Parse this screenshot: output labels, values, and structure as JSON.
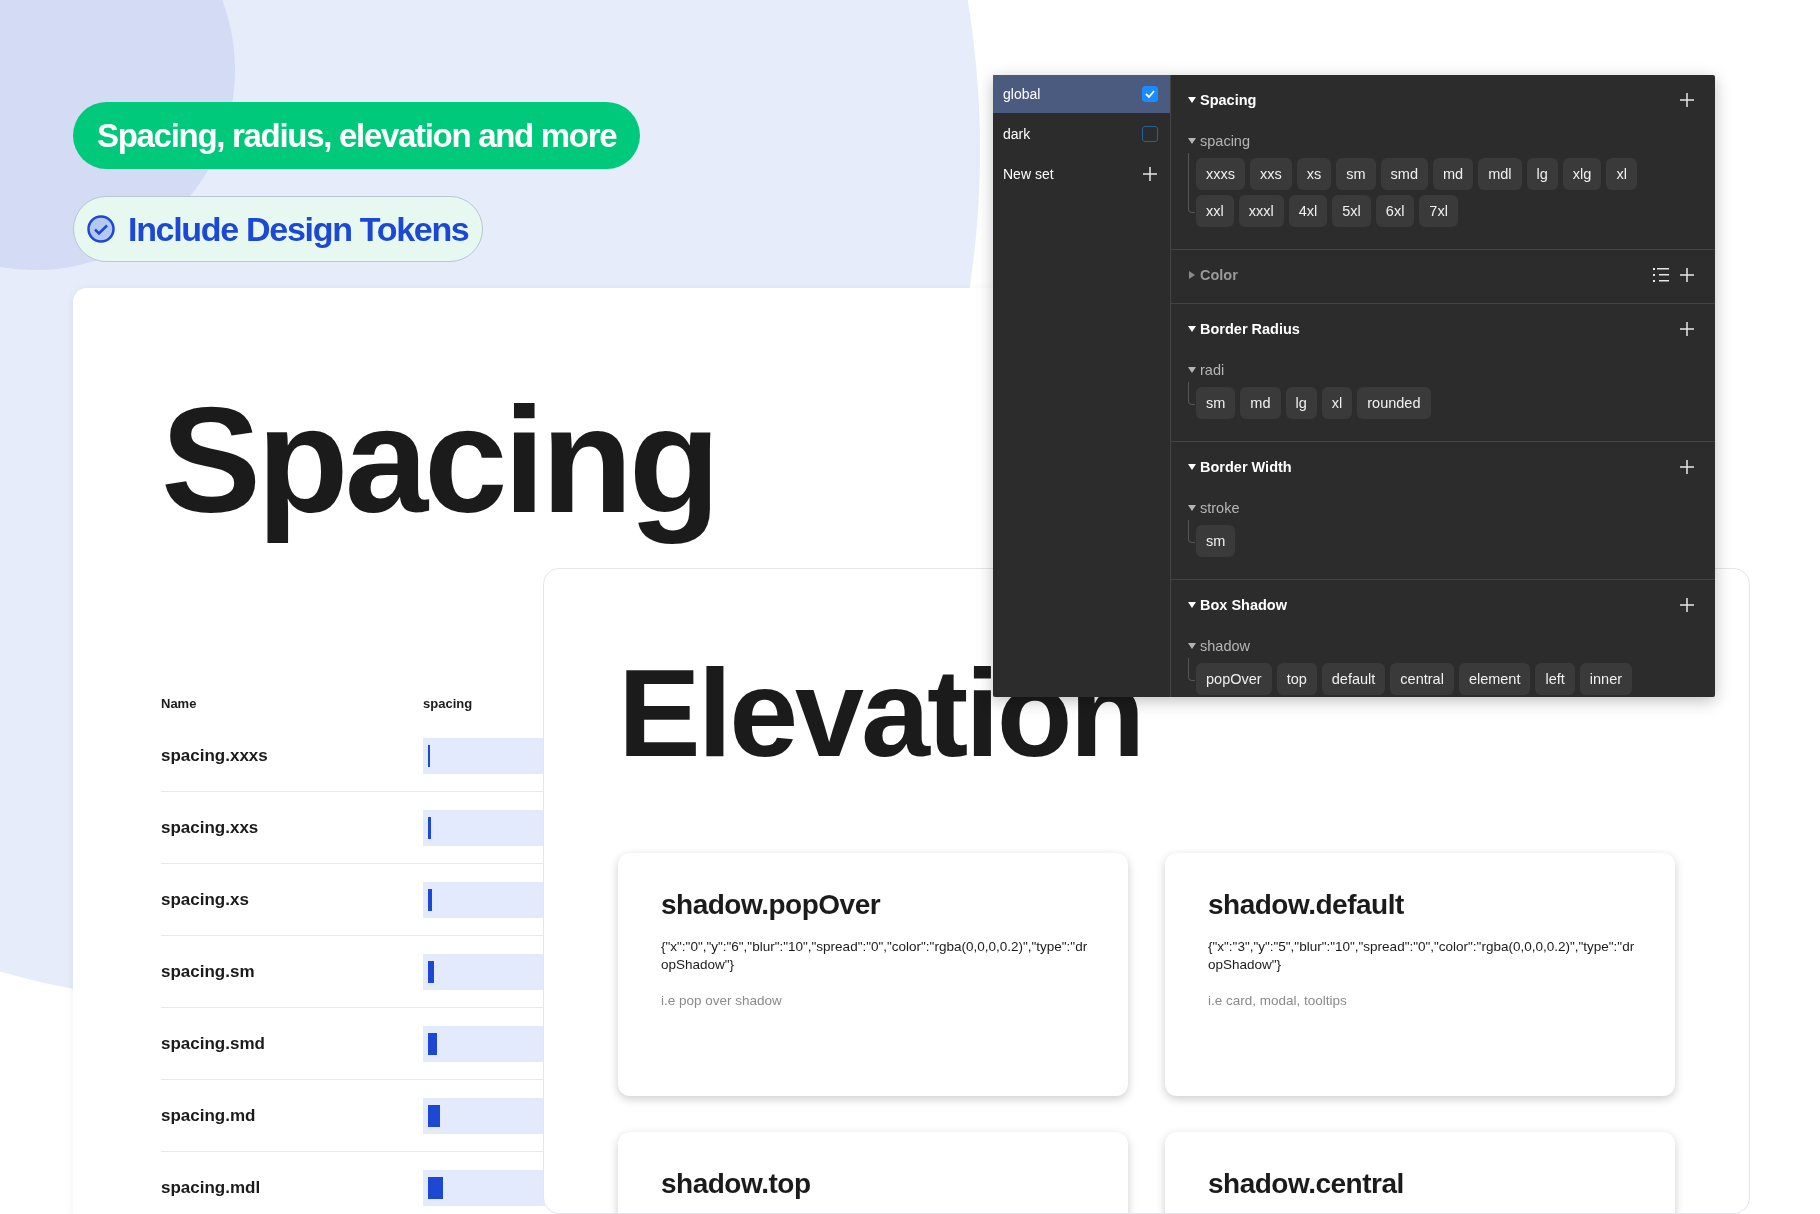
{
  "headline_badge": {
    "text": "Spacing, radius, elevation and more"
  },
  "feature_badge": {
    "text": "Include Design Tokens"
  },
  "spacing_card": {
    "title": "Spacing",
    "columns": [
      "Name",
      "spacing"
    ],
    "rows": [
      {
        "name": "spacing.xxxs",
        "level": 0.01
      },
      {
        "name": "spacing.xxs",
        "level": 0.015
      },
      {
        "name": "spacing.xs",
        "level": 0.02
      },
      {
        "name": "spacing.sm",
        "level": 0.03
      },
      {
        "name": "spacing.smd",
        "level": 0.045
      },
      {
        "name": "spacing.md",
        "level": 0.06
      },
      {
        "name": "spacing.mdl",
        "level": 0.075
      }
    ]
  },
  "elevation_card": {
    "title": "Elevation",
    "cards": [
      {
        "title": "shadow.popOver",
        "value": "{\"x\":\"0\",\"y\":\"6\",\"blur\":\"10\",\"spread\":\"0\",\"color\":\"rgba(0,0,0,0.2)\",\"type\":\"dropShadow\"}",
        "description": "i.e pop over shadow"
      },
      {
        "title": "shadow.default",
        "value": "{\"x\":\"3\",\"y\":\"5\",\"blur\":\"10\",\"spread\":\"0\",\"color\":\"rgba(0,0,0,0.2)\",\"type\":\"dropShadow\"}",
        "description": "i.e card, modal, tooltips"
      },
      {
        "title": "shadow.top"
      },
      {
        "title": "shadow.central"
      }
    ]
  },
  "token_panel": {
    "sets": [
      {
        "label": "global",
        "selected": true,
        "kind": "checkbox",
        "checked": true
      },
      {
        "label": "dark",
        "selected": false,
        "kind": "checkbox",
        "checked": false
      },
      {
        "label": "New set",
        "selected": false,
        "kind": "add"
      }
    ],
    "sections": [
      {
        "title": "Spacing",
        "expanded": true,
        "list_view": false,
        "groups": [
          {
            "name": "spacing",
            "expanded": true,
            "tokens": [
              "xxxs",
              "xxs",
              "xs",
              "sm",
              "smd",
              "md",
              "mdl",
              "lg",
              "xlg",
              "xl",
              "xxl",
              "xxxl",
              "4xl",
              "5xl",
              "6xl",
              "7xl"
            ]
          }
        ]
      },
      {
        "title": "Color",
        "expanded": false,
        "list_view": true
      },
      {
        "title": "Border Radius",
        "expanded": true,
        "list_view": false,
        "groups": [
          {
            "name": "radi",
            "expanded": true,
            "tokens": [
              "sm",
              "md",
              "lg",
              "xl",
              "rounded"
            ]
          }
        ]
      },
      {
        "title": "Border Width",
        "expanded": true,
        "list_view": false,
        "groups": [
          {
            "name": "stroke",
            "expanded": true,
            "tokens": [
              "sm"
            ]
          }
        ]
      },
      {
        "title": "Box Shadow",
        "expanded": true,
        "list_view": false,
        "groups": [
          {
            "name": "shadow",
            "expanded": true,
            "tokens": [
              "popOver",
              "top",
              "default",
              "central",
              "element",
              "left",
              "inner"
            ]
          }
        ]
      }
    ]
  }
}
